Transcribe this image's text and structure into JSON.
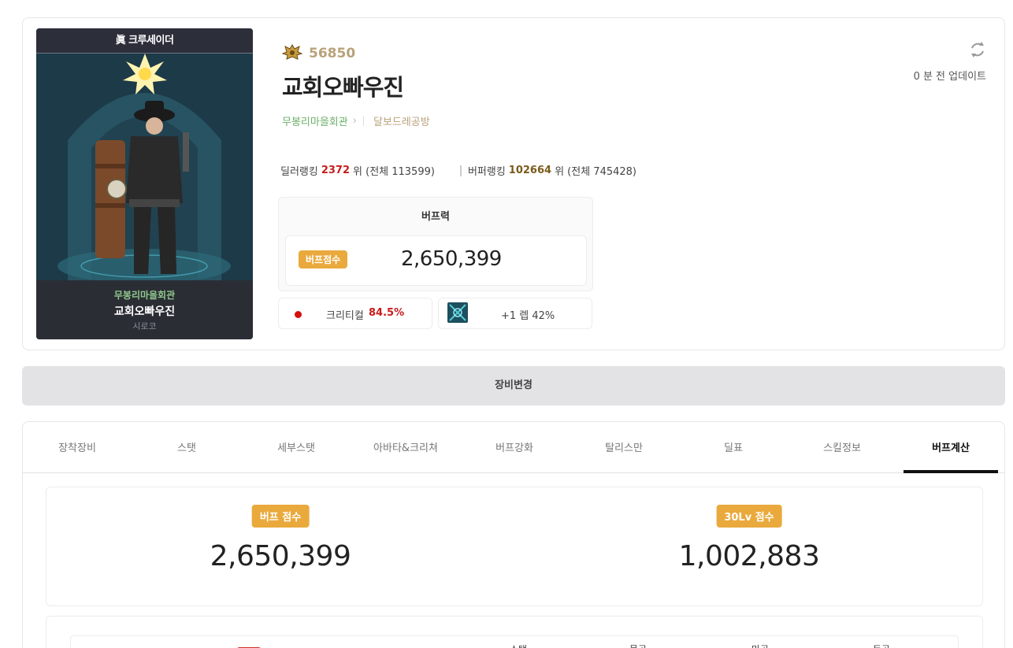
{
  "character": {
    "job_title": "眞 크루세이더",
    "guild": "무봉리마을회관",
    "name": "교회오빠우진",
    "server": "시로코",
    "fame": "56850",
    "adventure": "달보드레공방",
    "updated": "0 분 전 업데이트"
  },
  "ranking": {
    "dealer_label": "딜러랭킹",
    "dealer_rank": "2372",
    "dealer_suffix": "위 (전체 113599)",
    "buffer_label": "버퍼랭킹",
    "buffer_rank": "102664",
    "buffer_suffix": "위 (전체 745428)"
  },
  "buff_panel": {
    "header": "버프력",
    "badge": "버프점수",
    "score": "2,650,399",
    "crit_label": "크리티컬",
    "crit_value": "84.5%",
    "level_text": "+1 렙 42%"
  },
  "equip_change": "장비변경",
  "tabs": [
    {
      "label": "장착장비",
      "active": false
    },
    {
      "label": "스탯",
      "active": false
    },
    {
      "label": "세부스탯",
      "active": false
    },
    {
      "label": "아바타&크리쳐",
      "active": false
    },
    {
      "label": "버프강화",
      "active": false
    },
    {
      "label": "탈리스만",
      "active": false
    },
    {
      "label": "딜표",
      "active": false
    },
    {
      "label": "스킬정보",
      "active": false
    },
    {
      "label": "버프계산",
      "active": true
    }
  ],
  "scores": {
    "buff_badge": "버프 점수",
    "buff_value": "2,650,399",
    "lv30_badge": "30Lv 점수",
    "lv30_value": "1,002,883"
  },
  "table_headers": [
    "스탯",
    "물공",
    "마공",
    "독공"
  ],
  "colors": {
    "accent": "#e9a93c",
    "guild_green": "#6db06a",
    "fame_tan": "#b9a27a",
    "rank_red": "#c81c1c"
  }
}
